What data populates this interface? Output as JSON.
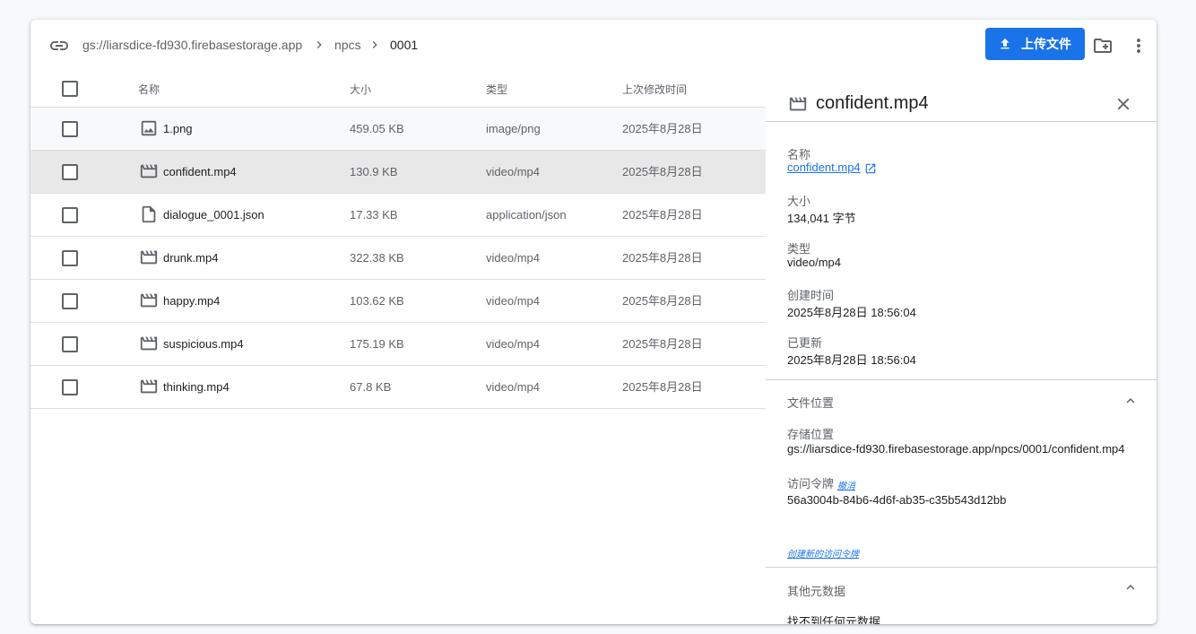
{
  "breadcrumb": {
    "icon": "link-icon",
    "items": [
      "gs://liarsdice-fd930.firebasestorage.app",
      "npcs",
      "0001"
    ]
  },
  "toolbar": {
    "upload_label": "上传文件",
    "new_folder_icon": "create-folder-icon",
    "more_icon": "more-vert-icon"
  },
  "colors": {
    "accent": "#1a73e8",
    "selected_row": "#e8e8e8",
    "hover_row": "#f8f9fa"
  },
  "table": {
    "columns": [
      "名称",
      "大小",
      "类型",
      "上次修改时间"
    ],
    "rows": [
      {
        "name": "1.png",
        "size": "459.05 KB",
        "type": "image/png",
        "modified": "2025年8月28日",
        "icon": "image-icon"
      },
      {
        "name": "confident.mp4",
        "size": "130.9 KB",
        "type": "video/mp4",
        "modified": "2025年8月28日",
        "icon": "video-icon"
      },
      {
        "name": "dialogue_0001.json",
        "size": "17.33 KB",
        "type": "application/json",
        "modified": "2025年8月28日",
        "icon": "file-icon"
      },
      {
        "name": "drunk.mp4",
        "size": "322.38 KB",
        "type": "video/mp4",
        "modified": "2025年8月28日",
        "icon": "video-icon"
      },
      {
        "name": "happy.mp4",
        "size": "103.62 KB",
        "type": "video/mp4",
        "modified": "2025年8月28日",
        "icon": "video-icon"
      },
      {
        "name": "suspicious.mp4",
        "size": "175.19 KB",
        "type": "video/mp4",
        "modified": "2025年8月28日",
        "icon": "video-icon"
      },
      {
        "name": "thinking.mp4",
        "size": "67.8 KB",
        "type": "video/mp4",
        "modified": "2025年8月28日",
        "icon": "video-icon"
      }
    ]
  },
  "details": {
    "title": "confident.mp4",
    "name_label": "名称",
    "name_value": "confident.mp4",
    "size_label": "大小",
    "size_value": "134,041 字节",
    "type_label": "类型",
    "type_value": "video/mp4",
    "created_label": "创建时间",
    "created_value": "2025年8月28日 18:56:04",
    "updated_label": "已更新",
    "updated_value": "2025年8月28日 18:56:04",
    "location_section": "文件位置",
    "storage_label": "存储位置",
    "storage_value": "gs://liarsdice-fd930.firebasestorage.app/npcs/0001/confident.mp4",
    "token_label": "访问令牌",
    "revoke_label": "撤消",
    "token_value": "56a3004b-84b6-4d6f-ab35-c35b543d12bb",
    "create_token_label": "创建新的访问令牌",
    "metadata_section": "其他元数据",
    "metadata_empty": "找不到任何元数据"
  }
}
